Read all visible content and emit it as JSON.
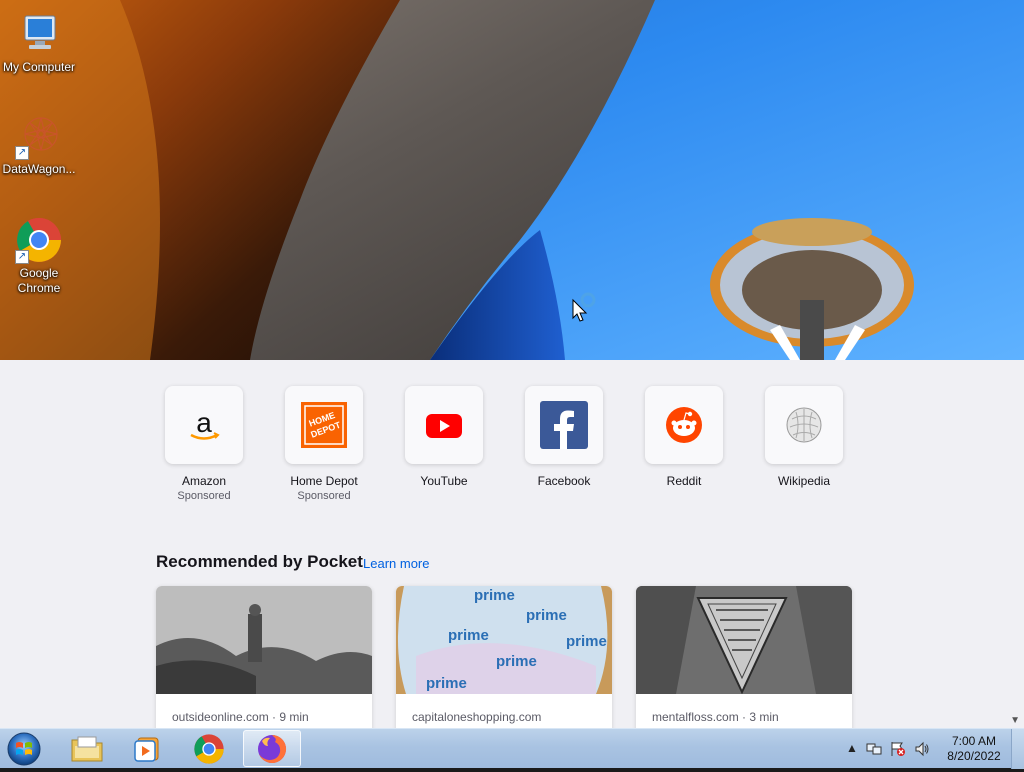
{
  "desktop": {
    "icons": [
      {
        "label": "My Computer"
      },
      {
        "label": "DataWagon..."
      },
      {
        "label": "Google Chrome"
      }
    ]
  },
  "newtab": {
    "top_sites": [
      {
        "label": "Amazon",
        "sub": "Sponsored",
        "icon": "amazon-icon"
      },
      {
        "label": "Home Depot",
        "sub": "Sponsored",
        "icon": "home-depot-icon"
      },
      {
        "label": "YouTube",
        "sub": "",
        "icon": "youtube-icon"
      },
      {
        "label": "Facebook",
        "sub": "",
        "icon": "facebook-icon"
      },
      {
        "label": "Reddit",
        "sub": "",
        "icon": "reddit-icon"
      },
      {
        "label": "Wikipedia",
        "sub": "",
        "icon": "wikipedia-icon"
      }
    ],
    "pocket": {
      "heading": "Recommended by Pocket",
      "learn_more": "Learn more",
      "cards": [
        {
          "source": "outsideonline.com · 9 min"
        },
        {
          "source": "capitaloneshopping.com"
        },
        {
          "source": "mentalfloss.com · 3 min"
        }
      ]
    }
  },
  "taskbar": {
    "pinned": [
      "windows-explorer",
      "media-player",
      "google-chrome",
      "firefox"
    ],
    "active": "firefox",
    "clock": {
      "time": "7:00 AM",
      "date": "8/20/2022"
    }
  },
  "colors": {
    "newtab_bg": "#f0f0f4",
    "link": "#0061e0",
    "youtube_red": "#ff0000",
    "facebook_blue": "#3b5998",
    "reddit_orange": "#ff4500"
  }
}
